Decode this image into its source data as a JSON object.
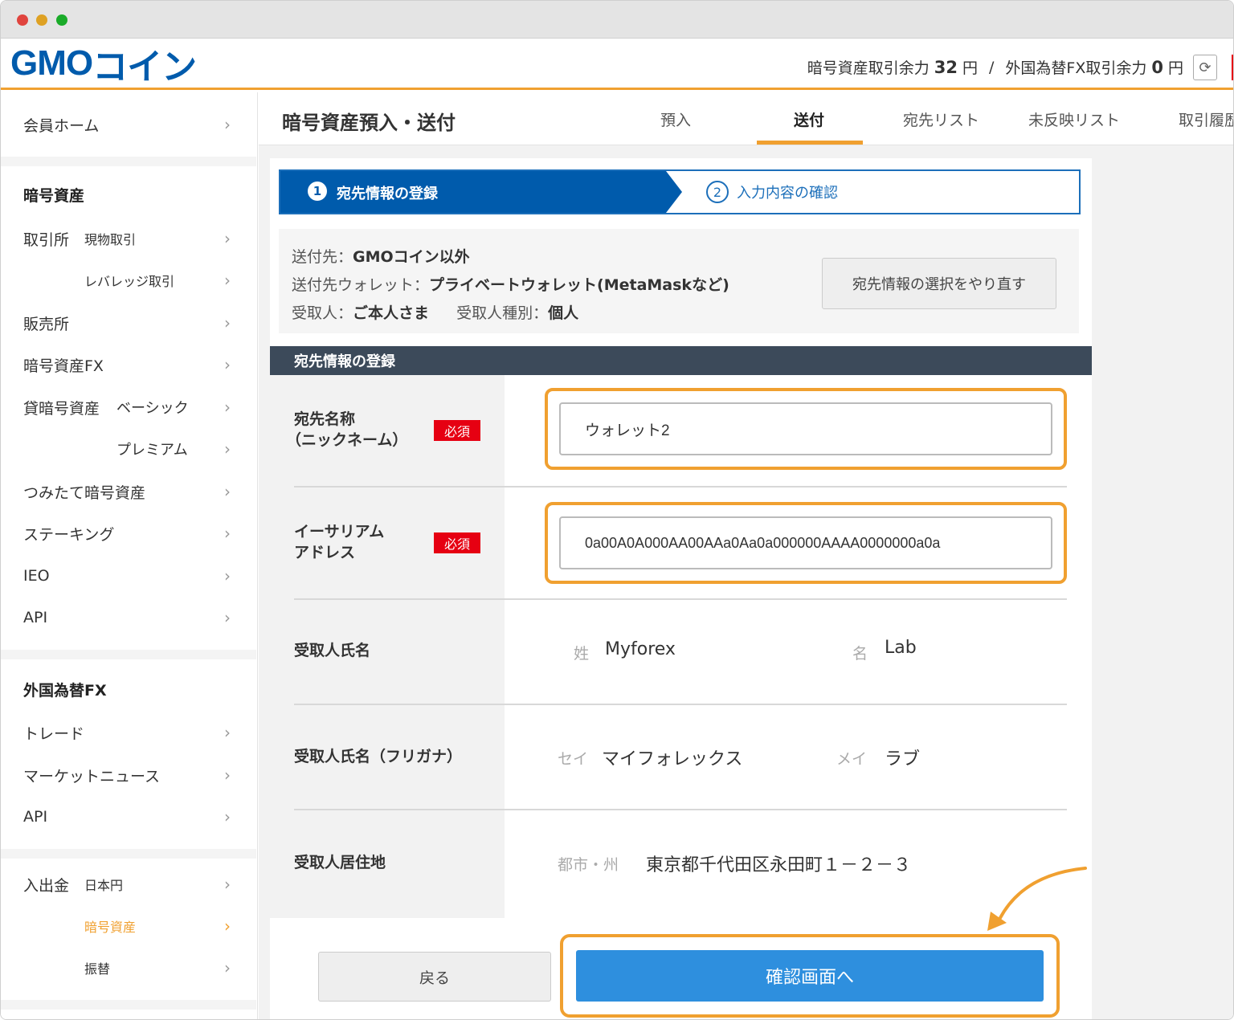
{
  "header": {
    "brand_left": "GMO",
    "brand_right": "コイン",
    "crypto_balance_label": "暗号資産取引余力",
    "crypto_balance_value": "32",
    "currency": "円",
    "separator": "/",
    "fx_balance_label": "外国為替FX取引余力",
    "fx_balance_value": "0",
    "refresh_icon": "refresh-icon"
  },
  "sidebar": {
    "member_home": "会員ホーム",
    "crypto_heading": "暗号資産",
    "exchange": "取引所",
    "spot": "現物取引",
    "leverage": "レバレッジ取引",
    "sales": "販売所",
    "crypto_fx": "暗号資産FX",
    "lending": "貸暗号資産",
    "basic": "ベーシック",
    "premium": "プレミアム",
    "tsumitate": "つみたて暗号資産",
    "staking": "ステーキング",
    "ieo": "IEO",
    "api": "API",
    "fx_heading": "外国為替FX",
    "trade": "トレード",
    "market_news": "マーケットニュース",
    "fx_api": "API",
    "deposit": "入出金",
    "jpy": "日本円",
    "crypto": "暗号資産",
    "transfer": "振替",
    "chevron": "›"
  },
  "page": {
    "title": "暗号資産預入・送付",
    "tabs": [
      "預入",
      "送付",
      "宛先リスト",
      "未反映リスト",
      "取引履歴"
    ]
  },
  "steps": {
    "step1_num": "1",
    "step1_label": "宛先情報の登録",
    "step2_num": "2",
    "step2_label": "入力内容の確認"
  },
  "summary": {
    "dest_label": "送付先：",
    "dest_value": "GMOコイン以外",
    "wallet_label": "送付先ウォレット：",
    "wallet_value": "プライベートウォレット(MetaMaskなど)",
    "recipient_label": "受取人：",
    "recipient_value": "ご本人さま",
    "type_label": "受取人種別：",
    "type_value": "個人",
    "redo_button": "宛先情報の選択をやり直す"
  },
  "form": {
    "section_title": "宛先情報の登録",
    "required": "必須",
    "nickname_label_1": "宛先名称",
    "nickname_label_2": "（ニックネーム）",
    "nickname_value": "ウォレット2",
    "address_label_1": "イーサリアム",
    "address_label_2": "アドレス",
    "address_value": "0a00A0A000AA00AAa0Aa0a000000AAAA0000000a0a",
    "name_label": "受取人氏名",
    "last_name_label": "姓",
    "last_name_value": "Myforex",
    "first_name_label": "名",
    "first_name_value": "Lab",
    "kana_label": "受取人氏名（フリガナ）",
    "sei_label": "セイ",
    "sei_value": "マイフォレックス",
    "mei_label": "メイ",
    "mei_value": "ラブ",
    "address_res_label": "受取人居住地",
    "city_label": "都市・州",
    "city_value": "東京都千代田区永田町１－２－３"
  },
  "buttons": {
    "back": "戻る",
    "confirm": "確認画面へ"
  },
  "colors": {
    "accent_orange": "#f0a030",
    "brand_blue": "#005bac",
    "button_blue": "#2e8fde",
    "required_red": "#e60012"
  }
}
